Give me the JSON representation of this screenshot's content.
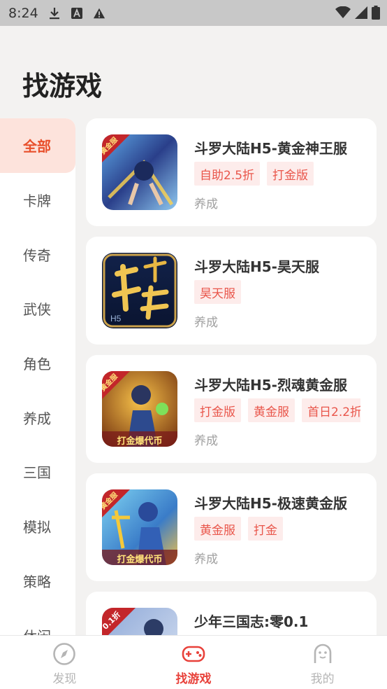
{
  "status_bar": {
    "time": "8:24"
  },
  "page_title": "找游戏",
  "categories": [
    "全部",
    "卡牌",
    "传奇",
    "武侠",
    "角色",
    "养成",
    "三国",
    "模拟",
    "策略",
    "休闲"
  ],
  "games": [
    {
      "title": "斗罗大陆H5-黄金神王服",
      "tags": [
        "自助2.5折",
        "打金版"
      ],
      "genre": "养成",
      "thumb_badge": "黄金服",
      "thumb_banner": ""
    },
    {
      "title": "斗罗大陆H5-昊天服",
      "tags": [
        "昊天服"
      ],
      "genre": "养成",
      "thumb_badge": "",
      "thumb_banner": ""
    },
    {
      "title": "斗罗大陆H5-烈魂黄金服",
      "tags": [
        "打金版",
        "黄金服",
        "首日2.2折"
      ],
      "genre": "养成",
      "thumb_badge": "黄金服",
      "thumb_banner": "打金爆代币"
    },
    {
      "title": "斗罗大陆H5-极速黄金版",
      "tags": [
        "黄金服",
        "打金"
      ],
      "genre": "养成",
      "thumb_badge": "黄金服",
      "thumb_banner": "打金爆代币"
    },
    {
      "title": "少年三国志:零0.1",
      "tags": [],
      "genre": "",
      "thumb_badge": "0.1折",
      "thumb_banner": ""
    }
  ],
  "bottom_nav": [
    {
      "label": "发现"
    },
    {
      "label": "找游戏"
    },
    {
      "label": "我的"
    }
  ],
  "colors": {
    "accent": "#e8502c",
    "tag_text": "#e9564b",
    "tag_bg": "#fdeceb",
    "active_cat_bg": "#fde3dc"
  }
}
